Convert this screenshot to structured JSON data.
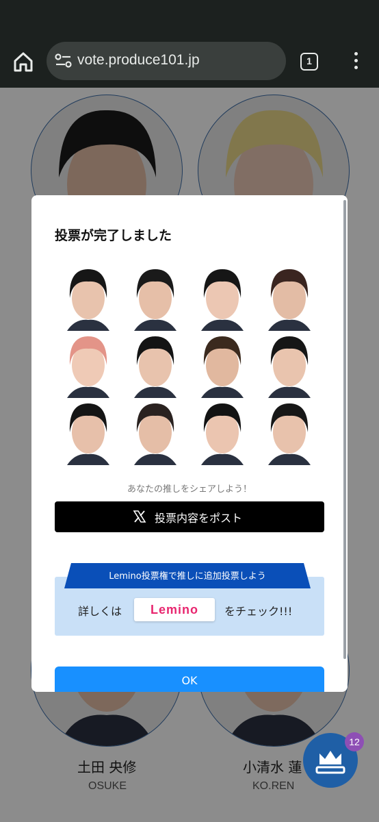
{
  "browser": {
    "url": "vote.produce101.jp",
    "tab_count": "1"
  },
  "background": {
    "trainees": [
      {
        "name": "土田 央修",
        "romaji": "OSUKE"
      },
      {
        "name": "小清水 蓮",
        "romaji": "KO.REN"
      }
    ]
  },
  "dialog": {
    "title": "投票が完了しました",
    "share_prompt": "あなたの推しをシェアしよう！",
    "post_button": "投票内容をポスト",
    "lemino_banner": "Lemino投票権で推しに追加投票しよう",
    "lemino_prefix": "詳しくは",
    "lemino_logo": "Lemino",
    "lemino_suffix": "をチェック!!!",
    "ok_button": "OK"
  },
  "fab": {
    "badge": "12"
  },
  "colors": {
    "accent": "#1890ff",
    "banner": "#0a4fb8",
    "lemino": "#e8266f"
  }
}
